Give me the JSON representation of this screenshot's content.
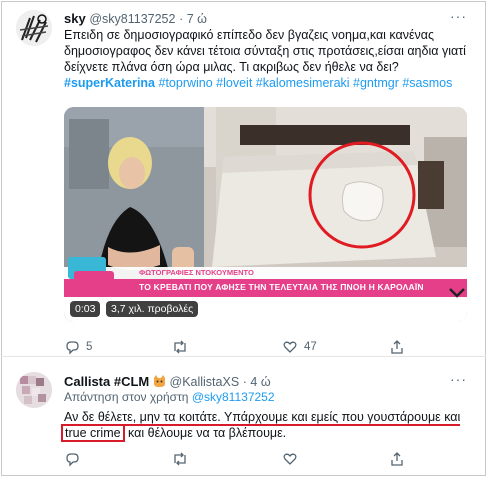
{
  "tweet1": {
    "name": "sky",
    "handle": "@sky81137252",
    "time": "· 7 ώ",
    "text_plain": "Επειδη σε δημοσιογραφικό επίπεδο δεν βγαζεις νοημα,και κανένας δημοσιογραφος δεν κάνει τέτοια σύνταξη  στις προτάσεις,είσαι αηδια γιατί δείχνετε πλάνα όση ώρα μιλας.  Τι ακριβως δεν ήθελε να δει?",
    "hashtags": "#superKaterina #toprwino #loveit #kalomesimeraki #gntmgr #sasmos",
    "hashtag_first": "#superKaterina",
    "hashtag_rest": " #toprwino #loveit #kalomesimeraki #gntmgr #sasmos",
    "media": {
      "banner_top": "ΦΩΤΟΓΡΑΦΙΕΣ ΝΤΟΚΟΥΜΕΝΤΟ",
      "banner_main": "ΤΟ ΚΡΕΒΑΤΙ ΠΟΥ ΑΦΗΣΕ ΤΗΝ ΤΕΛΕΥΤΑΙΑ ΤΗΣ ΠΝΟΗ Η ΚΑΡΟΛΑΪΝ",
      "logo_text": "SUPER KATERINA",
      "time": "0:03",
      "views": "3,7 χιλ. προβολές"
    },
    "stats": {
      "replies": "5",
      "retweets": "",
      "likes": "47"
    }
  },
  "tweet2": {
    "name": "Callista #CLM",
    "handle": "@KallistaXS",
    "time": "· 4 ώ",
    "reply_prefix": "Απάντηση στον χρήστη",
    "reply_to": "@sky81137252",
    "text_line1": "Αν δε θέλετε, μην τα κοιτάτε. Υπάρχουμε και εμείς που γουστάρουμε και",
    "text_highlight": "true crime",
    "text_line2_rest": " και θέλουμε να τα βλέπουμε.",
    "stats": {
      "replies": "",
      "retweets": "",
      "likes": ""
    }
  },
  "colors": {
    "accent": "#1d9bf0",
    "annotation": "#d81b2a",
    "muted": "#536471"
  }
}
